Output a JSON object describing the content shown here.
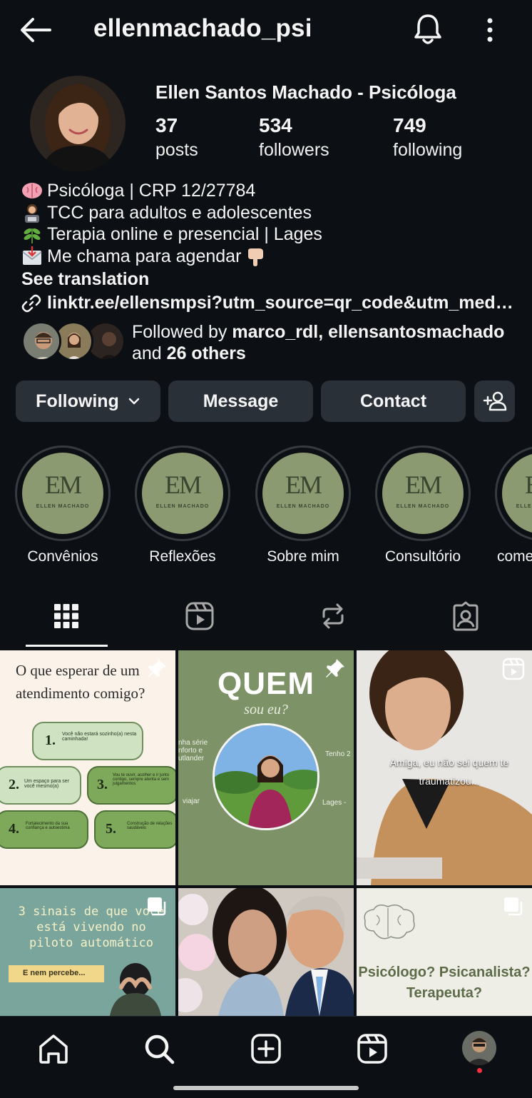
{
  "header": {
    "username": "ellenmachado_psi"
  },
  "profile": {
    "full_name": "Ellen Santos Machado - Psicóloga",
    "stats": [
      {
        "value": "37",
        "label": "posts"
      },
      {
        "value": "534",
        "label": "followers"
      },
      {
        "value": "749",
        "label": "following"
      }
    ],
    "bio": [
      {
        "emoji": "brain-emoji",
        "text": "Psicóloga | CRP 12/27784"
      },
      {
        "emoji": "technologist-emoji",
        "text": "TCC para adultos e adolescentes"
      },
      {
        "emoji": "herb-emoji",
        "text": "Terapia online e presencial | Lages"
      },
      {
        "emoji": "inbox-emoji",
        "text": "Me chama para agendar",
        "suffix_emoji": "pointing-down-emoji"
      }
    ],
    "see_translation": "See translation",
    "link": "linktr.ee/ellensmpsi?utm_source=qr_code&utm_mediu…",
    "followed_by": {
      "prefix": "Followed by ",
      "names": "marco_rdl, ellensantosmachado",
      "and": "and ",
      "others": "26 others"
    }
  },
  "actions": {
    "following": "Following",
    "message": "Message",
    "contact": "Contact"
  },
  "highlights": [
    {
      "label": "Convênios"
    },
    {
      "label": "Reflexões"
    },
    {
      "label": "Sobre mim"
    },
    {
      "label": "Consultório"
    },
    {
      "label": "come"
    }
  ],
  "highlight_cover": {
    "monogram": "EM",
    "name": "ELLEN MACHADO"
  },
  "posts": {
    "p1": {
      "title": "O que esperar de um atendimento comigo?",
      "items": [
        {
          "n": "1.",
          "t": "Você não estará sozinho(a) nesta caminhada!"
        },
        {
          "n": "2.",
          "t": "Um espaço para ser você mesmo(a)"
        },
        {
          "n": "3.",
          "t": "Vou te ouvir, acolher e ir junto contigo, sempre atenta e sem julgamentos"
        },
        {
          "n": "4.",
          "t": "Fortalecimento da sua confiança e autoestima"
        },
        {
          "n": "5.",
          "t": "Construção de relações saudáveis"
        }
      ]
    },
    "p2": {
      "title": "QUEM",
      "subtitle": "sou eu?",
      "left_a": "nha série",
      "left_b": "nforto e",
      "left_c": "utlander",
      "left_d": "viajar",
      "right_a": "Tenho 2",
      "right_b": "Lages -"
    },
    "p3": {
      "caption": "Amiga, eu não sei quem te traumatizou..."
    },
    "p4": {
      "title": "3 sinais de que você está vivendo no piloto automático",
      "tag": "E nem percebe..."
    },
    "p6": {
      "text": "Psicólogo? Psicanalista? Terapeuta?"
    }
  },
  "colors": {
    "background": "#0c1014",
    "button": "#2a3037",
    "highlight_green": "#8c9a72",
    "post_green": "#7e9268"
  }
}
